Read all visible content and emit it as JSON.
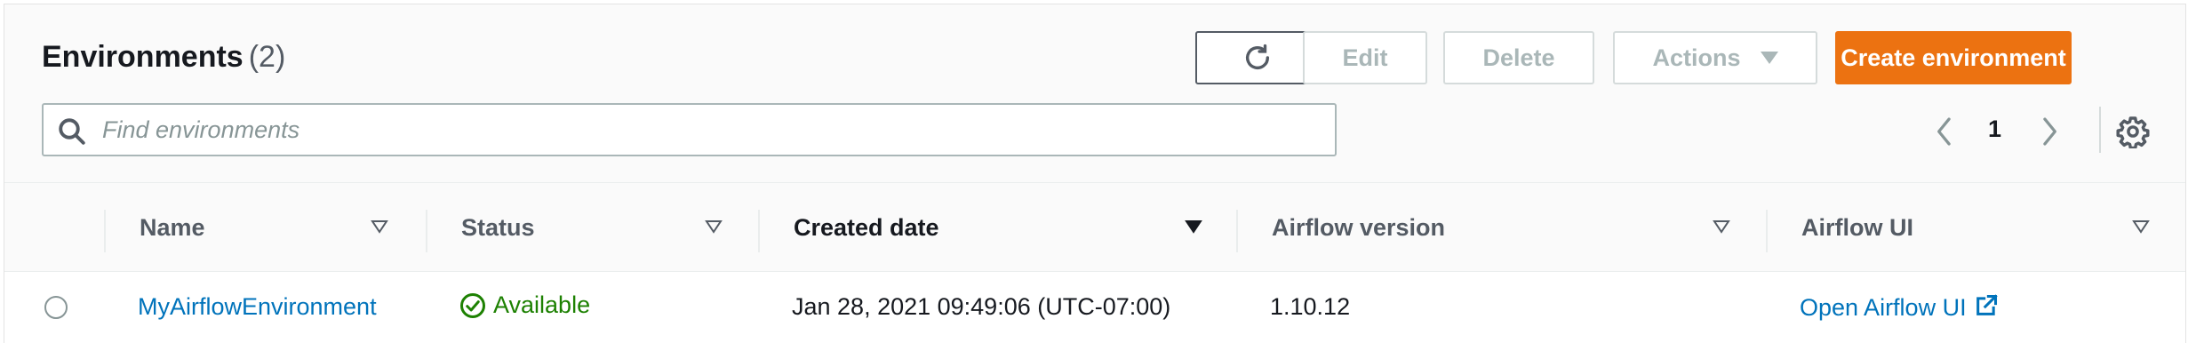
{
  "header": {
    "title": "Environments",
    "count": "(2)"
  },
  "toolbar": {
    "refresh_icon": "refresh-icon",
    "edit_label": "Edit",
    "delete_label": "Delete",
    "actions_label": "Actions",
    "create_label": "Create environment"
  },
  "search": {
    "placeholder": "Find environments",
    "value": ""
  },
  "pagination": {
    "current_page": "1"
  },
  "columns": [
    {
      "label": "Name"
    },
    {
      "label": "Status"
    },
    {
      "label": "Created date"
    },
    {
      "label": "Airflow version"
    },
    {
      "label": "Airflow UI"
    }
  ],
  "rows": [
    {
      "name": "MyAirflowEnvironment",
      "status": "Available",
      "created": "Jan 28, 2021 09:49:06 (UTC-07:00)",
      "airflow_version": "1.10.12",
      "airflow_ui": "Open Airflow UI"
    }
  ],
  "colors": {
    "accent_orange": "#ec7211",
    "link_blue": "#0073bb",
    "success_green": "#1d8102"
  }
}
